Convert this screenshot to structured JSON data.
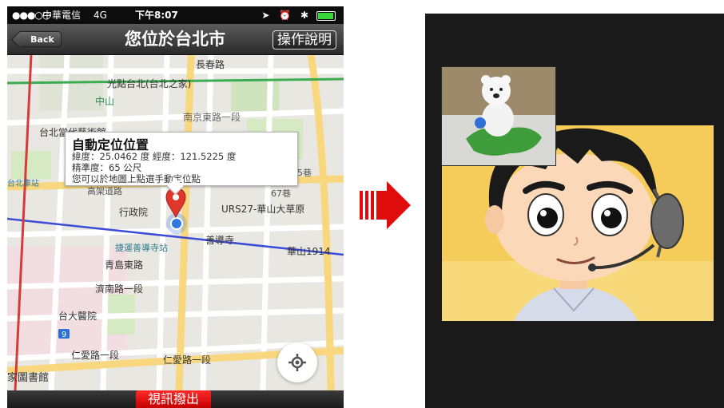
{
  "status_bar": {
    "signal": "●●●○○",
    "carrier": "中華電信",
    "network": "4G",
    "time": "下午8:07"
  },
  "nav_bar": {
    "back_label": "Back",
    "title": "您位於台北市",
    "help_label": "操作說明"
  },
  "map": {
    "labels": {
      "chang_chun_road": "長春路",
      "guang_dian": "光點台北(台北之家)",
      "zhongshan": "中山",
      "nanjing_east": "南京東路一段",
      "moca": "台北當代藝術館",
      "taipei_station": "台北車站",
      "lane_35": "35巷",
      "lane_7": "67巷",
      "executive_yuan": "行政院",
      "urs27": "URS27-華山大草原",
      "huashan": "華山1914",
      "shandao_temple": "善導寺",
      "shandao_mrt": "捷運善導寺站",
      "qingdao_east": "青島東路",
      "jinan_road": "濟南路一段",
      "ntuh": "台大醫院",
      "renai_road_1": "仁愛路一段",
      "renai_road_2": "仁愛路一段",
      "national_library": "家圖書館",
      "route_9": "9",
      "zhongxiao_bridge": "高架道路"
    }
  },
  "info_window": {
    "title": "自動定位位置",
    "coords": "緯度：25.0462 度 經度：121.5225 度",
    "accuracy": "精準度：65 公尺",
    "hint": "您可以於地圖上點選手動定位點"
  },
  "bottom_bar": {
    "video_call_label": "視訊撥出"
  },
  "colors": {
    "pin_red": "#e0362c",
    "accent_red": "#e00000",
    "arrow_red": "#e00b0b",
    "call_bg": "#f5cc59"
  },
  "icons": {
    "location_pin": "location-pin-icon",
    "current_location": "current-location-dot-icon",
    "locate_button": "crosshair-icon",
    "transition_arrow": "right-arrow-icon"
  }
}
